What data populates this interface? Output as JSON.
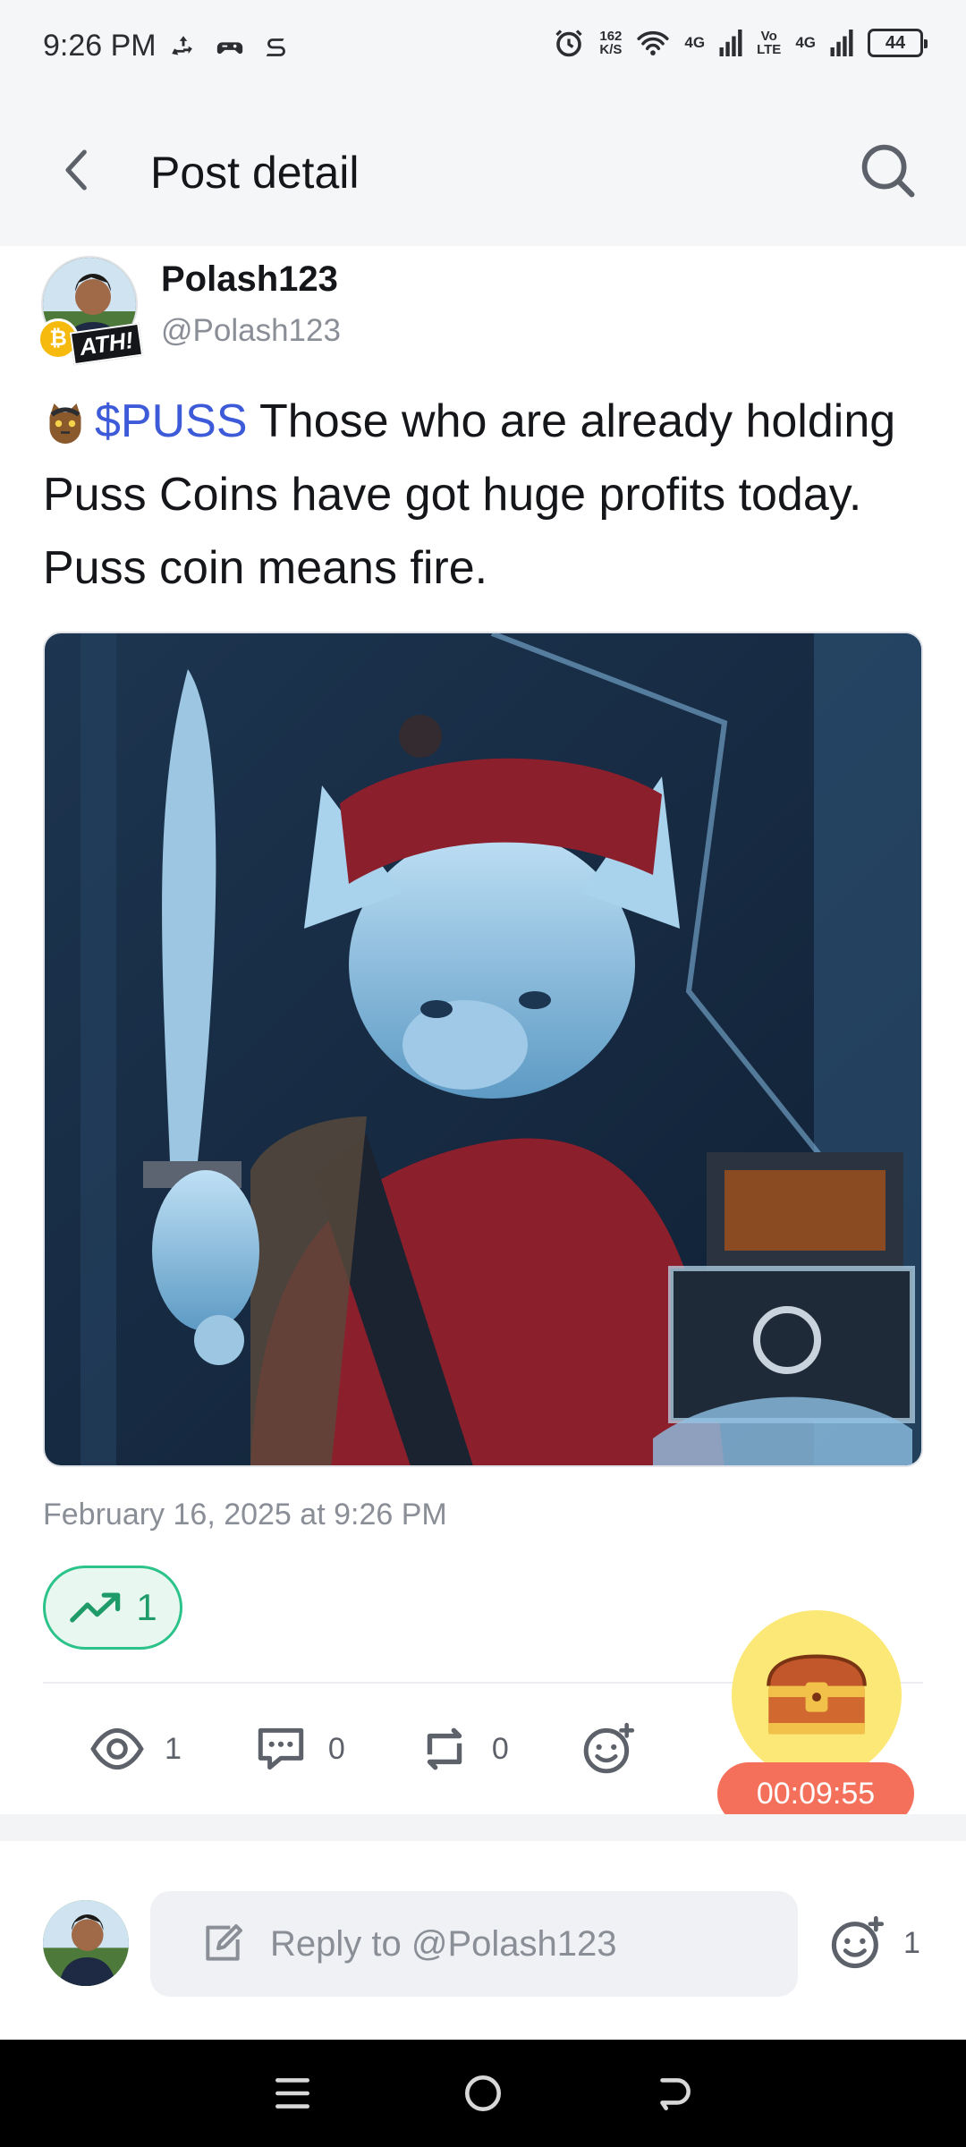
{
  "status_bar": {
    "time": "9:26 PM",
    "speed_value": "162",
    "speed_unit": "K/S",
    "net1": "4G",
    "net_volte_top": "Vo",
    "net_volte_bottom": "LTE",
    "net2": "4G",
    "battery": "44"
  },
  "header": {
    "title": "Post detail"
  },
  "post": {
    "author_name": "Polash123",
    "author_handle": "@Polash123",
    "ath_badge": "ATH!",
    "ticker": "$PUSS",
    "text": " Those who are already holding Puss Coins have got huge profits today.  Puss coin means fire.",
    "timestamp": "February 16, 2025 at 9:26 PM",
    "trend_count": "1"
  },
  "actions": {
    "views": "1",
    "comments": "0",
    "reposts": "0"
  },
  "reward": {
    "timer": "00:09:55"
  },
  "reply": {
    "placeholder": "Reply to @Polash123",
    "reaction_count": "1"
  },
  "colors": {
    "accent_ticker": "#3d5bd9",
    "trend_green": "#2cc38a",
    "timer_red": "#f5705a",
    "chest_yellow": "#fbe876"
  }
}
